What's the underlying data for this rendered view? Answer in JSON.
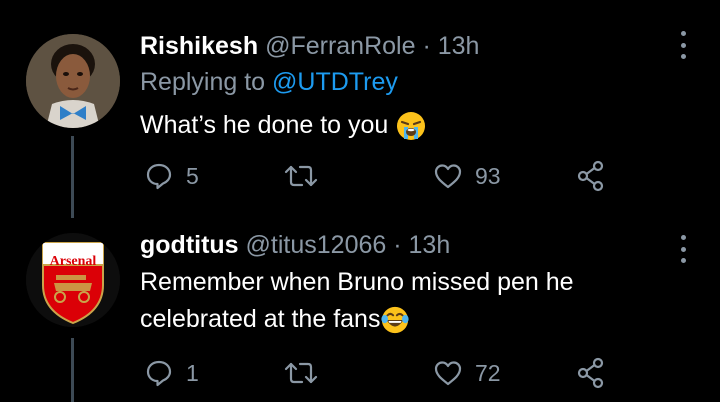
{
  "tweets": [
    {
      "display_name": "Rishikesh",
      "handle": "@FerranRole",
      "separator": "·",
      "time": "13h",
      "replying_prefix": "Replying to ",
      "replying_to": "@UTDTrey",
      "text_line1": "What’s he done to you",
      "emoji": "loudly-crying-face-emoji",
      "reply_count": "5",
      "retweet_count": "",
      "like_count": "93"
    },
    {
      "display_name": "godtitus",
      "handle": "@titus12066",
      "separator": "·",
      "time": "13h",
      "text_line1": "Remember when Bruno missed pen he",
      "text_line2": "celebrated at the fans",
      "emoji": "face-with-tears-of-joy-emoji",
      "avatar_badge_text": "Arsenal",
      "reply_count": "1",
      "retweet_count": "",
      "like_count": "72"
    }
  ],
  "colors": {
    "background": "#000000",
    "text": "#ffffff",
    "muted": "#8b98a5",
    "link": "#1d9bf0",
    "thread_line": "#3d4a55",
    "arsenal_red": "#db0007"
  },
  "icons": {
    "reply": "reply-icon",
    "retweet": "retweet-icon",
    "like": "heart-icon",
    "share": "share-icon",
    "more": "more-vertical-icon"
  }
}
